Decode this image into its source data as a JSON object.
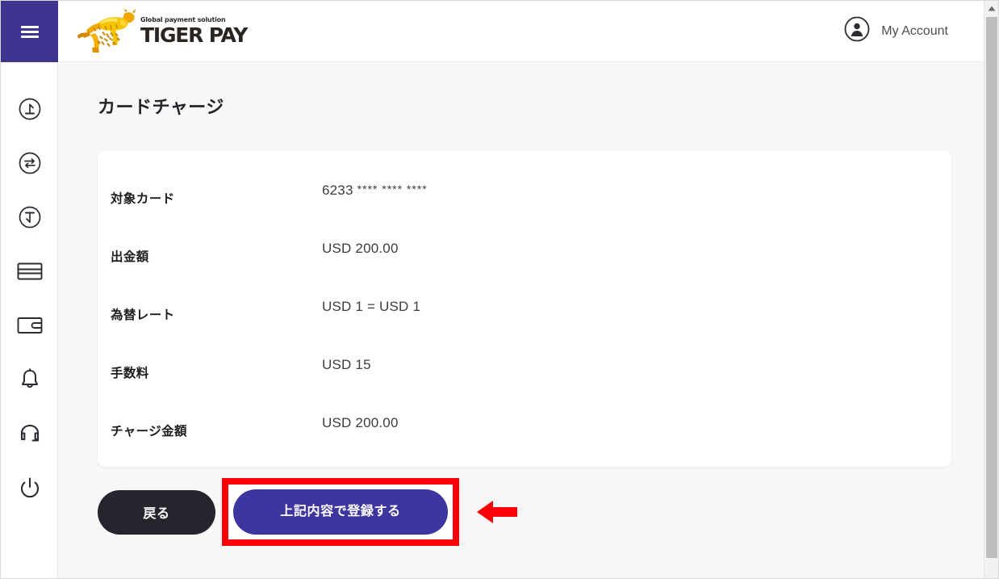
{
  "brand": {
    "tagline": "Global payment solution",
    "name": "TIGER PAY",
    "logo_icon": "tiger-logo-icon",
    "accent_purple": "#3d358f",
    "accent_button": "#3d35a0",
    "accent_dark": "#25252d",
    "annotation_red": "#fb0007"
  },
  "header": {
    "menu_icon": "hamburger-menu-icon",
    "account_icon": "user-circle-icon",
    "account_label": "My Account"
  },
  "sidebar": {
    "items": [
      {
        "icon": "deposit-arrow-up-circle-icon",
        "name": "sidebar-item-deposit"
      },
      {
        "icon": "exchange-arrows-circle-icon",
        "name": "sidebar-item-exchange"
      },
      {
        "icon": "withdraw-arrow-down-circle-icon",
        "name": "sidebar-item-withdraw"
      },
      {
        "icon": "credit-card-icon",
        "name": "sidebar-item-card"
      },
      {
        "icon": "wallet-icon",
        "name": "sidebar-item-wallet"
      },
      {
        "icon": "bell-icon",
        "name": "sidebar-item-notifications"
      },
      {
        "icon": "headset-icon",
        "name": "sidebar-item-support"
      },
      {
        "icon": "power-icon",
        "name": "sidebar-item-logout"
      }
    ]
  },
  "page": {
    "title": "カードチャージ"
  },
  "details": {
    "rows": [
      {
        "label": "対象カード",
        "value_prefix": "6233",
        "value_mask": "**** **** ****",
        "masked": true
      },
      {
        "label": "出金額",
        "value": "USD 200.00",
        "masked": false
      },
      {
        "label": "為替レート",
        "value": "USD 1 = USD 1",
        "masked": false
      },
      {
        "label": "手数料",
        "value": "USD 15",
        "masked": false
      },
      {
        "label": "チャージ金額",
        "value": "USD 200.00",
        "masked": false
      }
    ]
  },
  "actions": {
    "back_label": "戻る",
    "submit_label": "上記内容で登録する",
    "annotation_icon": "red-left-arrow-annotation-icon"
  },
  "scrollbar": {
    "up_arrow_icon": "scroll-up-arrow-icon",
    "thumb_name": "vertical-scroll-thumb"
  }
}
